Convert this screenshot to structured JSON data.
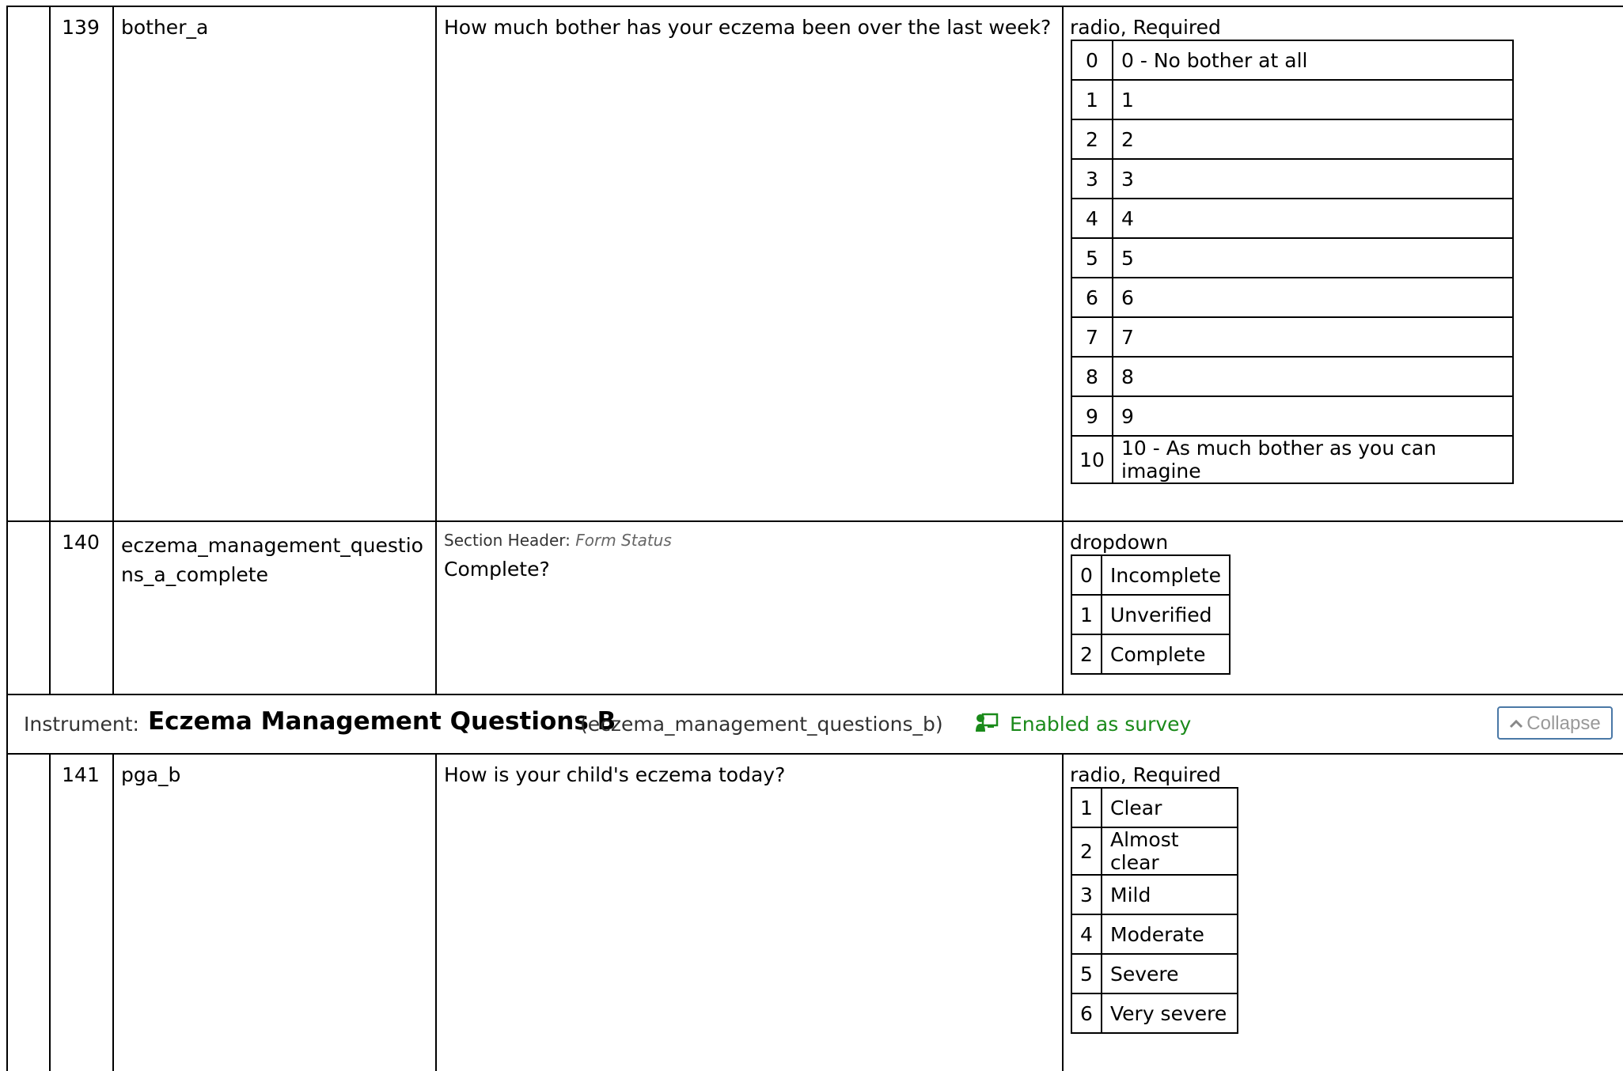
{
  "rows_top": [
    {
      "num": "139",
      "variable": "bother_a",
      "label": "How much bother has your eczema been over the last week?",
      "field_type": "radio, Required",
      "choices": [
        {
          "code": "0",
          "label": "0 - No bother at all"
        },
        {
          "code": "1",
          "label": "1"
        },
        {
          "code": "2",
          "label": "2"
        },
        {
          "code": "3",
          "label": "3"
        },
        {
          "code": "4",
          "label": "4"
        },
        {
          "code": "5",
          "label": "5"
        },
        {
          "code": "6",
          "label": "6"
        },
        {
          "code": "7",
          "label": "7"
        },
        {
          "code": "8",
          "label": "8"
        },
        {
          "code": "9",
          "label": "9"
        },
        {
          "code": "10",
          "label": "10 - As much bother as you can imagine"
        }
      ]
    },
    {
      "num": "140",
      "variable": "eczema_management_questions_a_complete",
      "section_header_label": "Section Header:",
      "section_header_value": "Form Status",
      "label": "Complete?",
      "field_type": "dropdown",
      "choices": [
        {
          "code": "0",
          "label": "Incomplete"
        },
        {
          "code": "1",
          "label": "Unverified"
        },
        {
          "code": "2",
          "label": "Complete"
        }
      ]
    }
  ],
  "instrument": {
    "prefix": "Instrument:",
    "title": "Eczema Management Questions B",
    "variable": "(eczema_management_questions_b)",
    "survey_status": "Enabled as survey",
    "survey_icon": "chalkboard-user-icon",
    "survey_color": "#1a8a1a",
    "collapse_label": "Collapse",
    "collapse_icon": "chevron-up-icon"
  },
  "rows_bottom": [
    {
      "num": "141",
      "variable": "pga_b",
      "label": "How is your child's eczema today?",
      "field_type": "radio, Required",
      "choices": [
        {
          "code": "1",
          "label": "Clear"
        },
        {
          "code": "2",
          "label": "Almost clear"
        },
        {
          "code": "3",
          "label": "Mild"
        },
        {
          "code": "4",
          "label": "Moderate"
        },
        {
          "code": "5",
          "label": "Severe"
        },
        {
          "code": "6",
          "label": "Very severe"
        }
      ]
    }
  ]
}
